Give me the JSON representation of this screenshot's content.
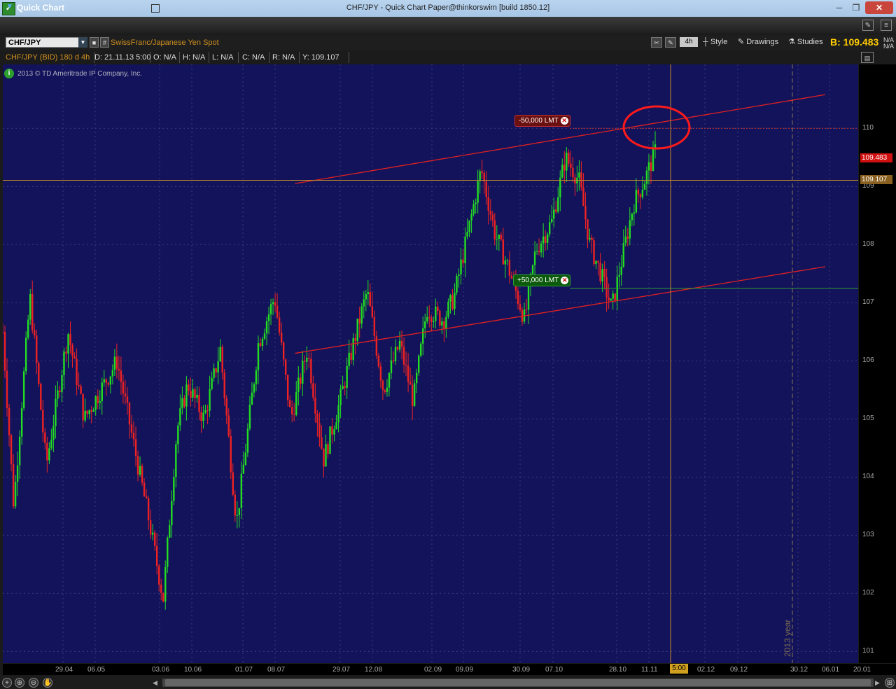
{
  "window": {
    "title": "CHF/JPY - Quick Chart Paper@thinkorswim [build 1850.12]",
    "minimize": "─",
    "maximize": "❐",
    "close": "✕"
  },
  "header": {
    "title": "Quick Chart"
  },
  "toolbar": {
    "symbol": "CHF/JPY",
    "description": "SwissFranc/Japanese Yen Spot",
    "timeframe": "4h",
    "style_label": "Style",
    "drawings_label": "Drawings",
    "studies_label": "Studies",
    "bid": "B: 109.483",
    "na_top": "N/A",
    "na_bottom": "N/A"
  },
  "info_row": {
    "symbol": "CHF/JPY (BID) 180 d 4h",
    "date": "D: 21.11.13 5:00",
    "open": "O: N/A",
    "high": "H: N/A",
    "low": "L: N/A",
    "close": "C: N/A",
    "range": "R: N/A",
    "y": "Y: 109.107"
  },
  "copyright": "2013 © TD Ameritrade IP Company, Inc.",
  "year_tag": "2013 year",
  "orders": {
    "sell": "-50,000 LMT",
    "buy": "+50,000 LMT"
  },
  "price_tags": {
    "last": "109.483",
    "cursor": "109.107"
  },
  "cursor_time": "5:00",
  "colors": {
    "up": "#22dd22",
    "down": "#ee2222",
    "background": "#13135b",
    "trendline": "#e02020",
    "cursor": "#c08a30"
  },
  "chart_data": {
    "type": "candlestick",
    "instrument": "CHF/JPY",
    "ylim": [
      100.8,
      111.1
    ],
    "y_ticks": [
      101,
      102,
      103,
      104,
      105,
      106,
      107,
      108,
      109,
      110
    ],
    "x_ticks": [
      "29.04",
      "06.05",
      "03.06",
      "10.06",
      "01.07",
      "08.07",
      "29.07",
      "12.08",
      "02.09",
      "09.09",
      "30.09",
      "07.10",
      "28.10",
      "11.11",
      "02.12",
      "09.12",
      "30.12",
      "06.01",
      "20.01"
    ],
    "path_points": [
      {
        "t": 0,
        "v": 106.5
      },
      {
        "t": 0.02,
        "v": 103.5
      },
      {
        "t": 0.05,
        "v": 107.1
      },
      {
        "t": 0.08,
        "v": 104.2
      },
      {
        "t": 0.12,
        "v": 106.5
      },
      {
        "t": 0.15,
        "v": 105.0
      },
      {
        "t": 0.18,
        "v": 105.5
      },
      {
        "t": 0.21,
        "v": 106.0
      },
      {
        "t": 0.24,
        "v": 104.6
      },
      {
        "t": 0.27,
        "v": 103.2
      },
      {
        "t": 0.295,
        "v": 101.9
      },
      {
        "t": 0.32,
        "v": 104.8
      },
      {
        "t": 0.34,
        "v": 105.6
      },
      {
        "t": 0.37,
        "v": 105.0
      },
      {
        "t": 0.4,
        "v": 106.2
      },
      {
        "t": 0.43,
        "v": 103.2
      },
      {
        "t": 0.47,
        "v": 106.3
      },
      {
        "t": 0.5,
        "v": 107.1
      },
      {
        "t": 0.53,
        "v": 105.0
      },
      {
        "t": 0.56,
        "v": 106.2
      },
      {
        "t": 0.59,
        "v": 104.3
      },
      {
        "t": 0.62,
        "v": 105.3
      },
      {
        "t": 0.645,
        "v": 106.3
      },
      {
        "t": 0.67,
        "v": 107.2
      },
      {
        "t": 0.7,
        "v": 105.5
      },
      {
        "t": 0.73,
        "v": 106.3
      },
      {
        "t": 0.755,
        "v": 105.3
      },
      {
        "t": 0.78,
        "v": 106.9
      },
      {
        "t": 0.81,
        "v": 106.7
      },
      {
        "t": 0.83,
        "v": 107.1
      },
      {
        "t": 0.86,
        "v": 108.4
      },
      {
        "t": 0.88,
        "v": 109.3
      },
      {
        "t": 0.905,
        "v": 108.2
      },
      {
        "t": 0.93,
        "v": 107.6
      },
      {
        "t": 0.96,
        "v": 106.7
      },
      {
        "t": 0.98,
        "v": 107.9
      },
      {
        "t": 1.01,
        "v": 108.4
      },
      {
        "t": 1.035,
        "v": 109.5
      },
      {
        "t": 1.06,
        "v": 109.1
      },
      {
        "t": 1.08,
        "v": 108.0
      },
      {
        "t": 1.1,
        "v": 107.5
      },
      {
        "t": 1.12,
        "v": 106.9
      },
      {
        "t": 1.14,
        "v": 107.8
      },
      {
        "t": 1.16,
        "v": 108.7
      },
      {
        "t": 1.18,
        "v": 109.1
      },
      {
        "t": 1.2,
        "v": 109.6
      }
    ],
    "channel": {
      "upper": [
        [
          0.448,
          109.05
        ],
        [
          1.0,
          110.58
        ]
      ],
      "lower": [
        [
          0.448,
          106.13
        ],
        [
          1.0,
          107.62
        ]
      ]
    },
    "levels": {
      "sell_limit": 110.0,
      "buy_limit": 107.25,
      "cursor_price": 109.107,
      "last_price": 109.483
    }
  }
}
